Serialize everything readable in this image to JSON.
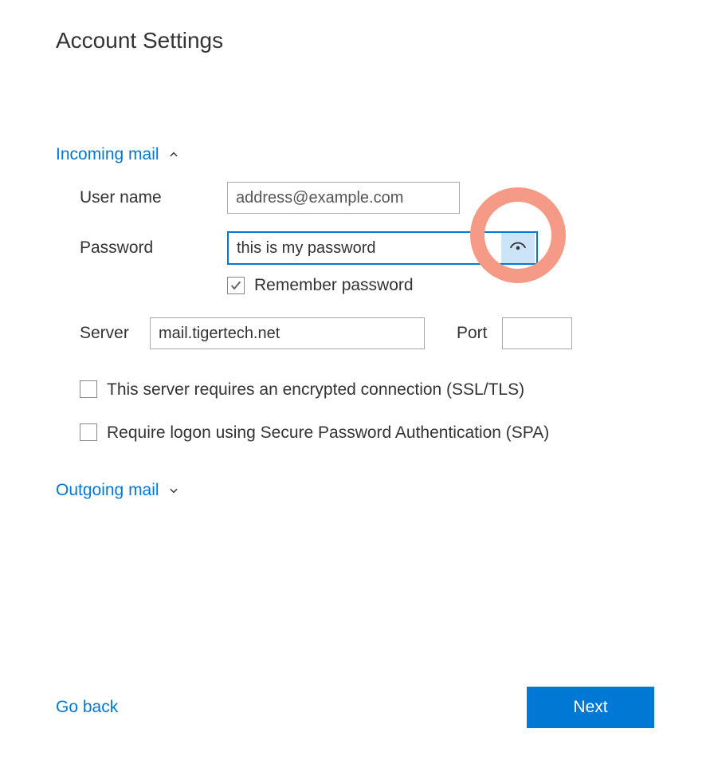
{
  "title": "Account Settings",
  "sections": {
    "incoming": {
      "header": "Incoming mail",
      "expanded": true,
      "fields": {
        "username_label": "User name",
        "username_value": "address@example.com",
        "password_label": "Password",
        "password_value": "this is my password",
        "remember_label": "Remember password",
        "remember_checked": true,
        "server_label": "Server",
        "server_value": "mail.tigertech.net",
        "port_label": "Port",
        "port_value": "",
        "ssl_label": "This server requires an encrypted connection (SSL/TLS)",
        "ssl_checked": false,
        "spa_label": "Require logon using Secure Password Authentication (SPA)",
        "spa_checked": false
      }
    },
    "outgoing": {
      "header": "Outgoing mail",
      "expanded": false
    }
  },
  "footer": {
    "go_back_label": "Go back",
    "next_label": "Next"
  },
  "annotation": {
    "highlight_color": "#f59a86"
  }
}
